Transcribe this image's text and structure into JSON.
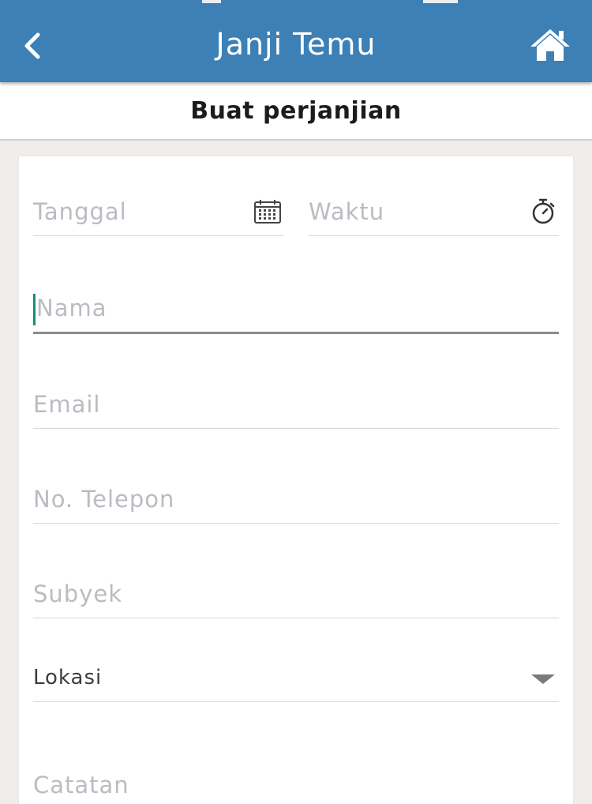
{
  "header": {
    "title": "Janji Temu",
    "back_icon": "chevron-left-icon",
    "home_icon": "home-icon",
    "background_color": "#3c80b6"
  },
  "subheader": {
    "title": "Buat perjanjian"
  },
  "form": {
    "date_placeholder": "Tanggal",
    "date_icon": "calendar-icon",
    "time_placeholder": "Waktu",
    "time_icon": "stopwatch-icon",
    "name_placeholder": "Nama",
    "email_placeholder": "Email",
    "phone_placeholder": "No. Telepon",
    "subject_placeholder": "Subyek",
    "location_selected": "Lokasi",
    "location_icon": "dropdown-arrow-icon",
    "notes_placeholder": "Catatan",
    "focus_color": "#1a8c7a"
  }
}
